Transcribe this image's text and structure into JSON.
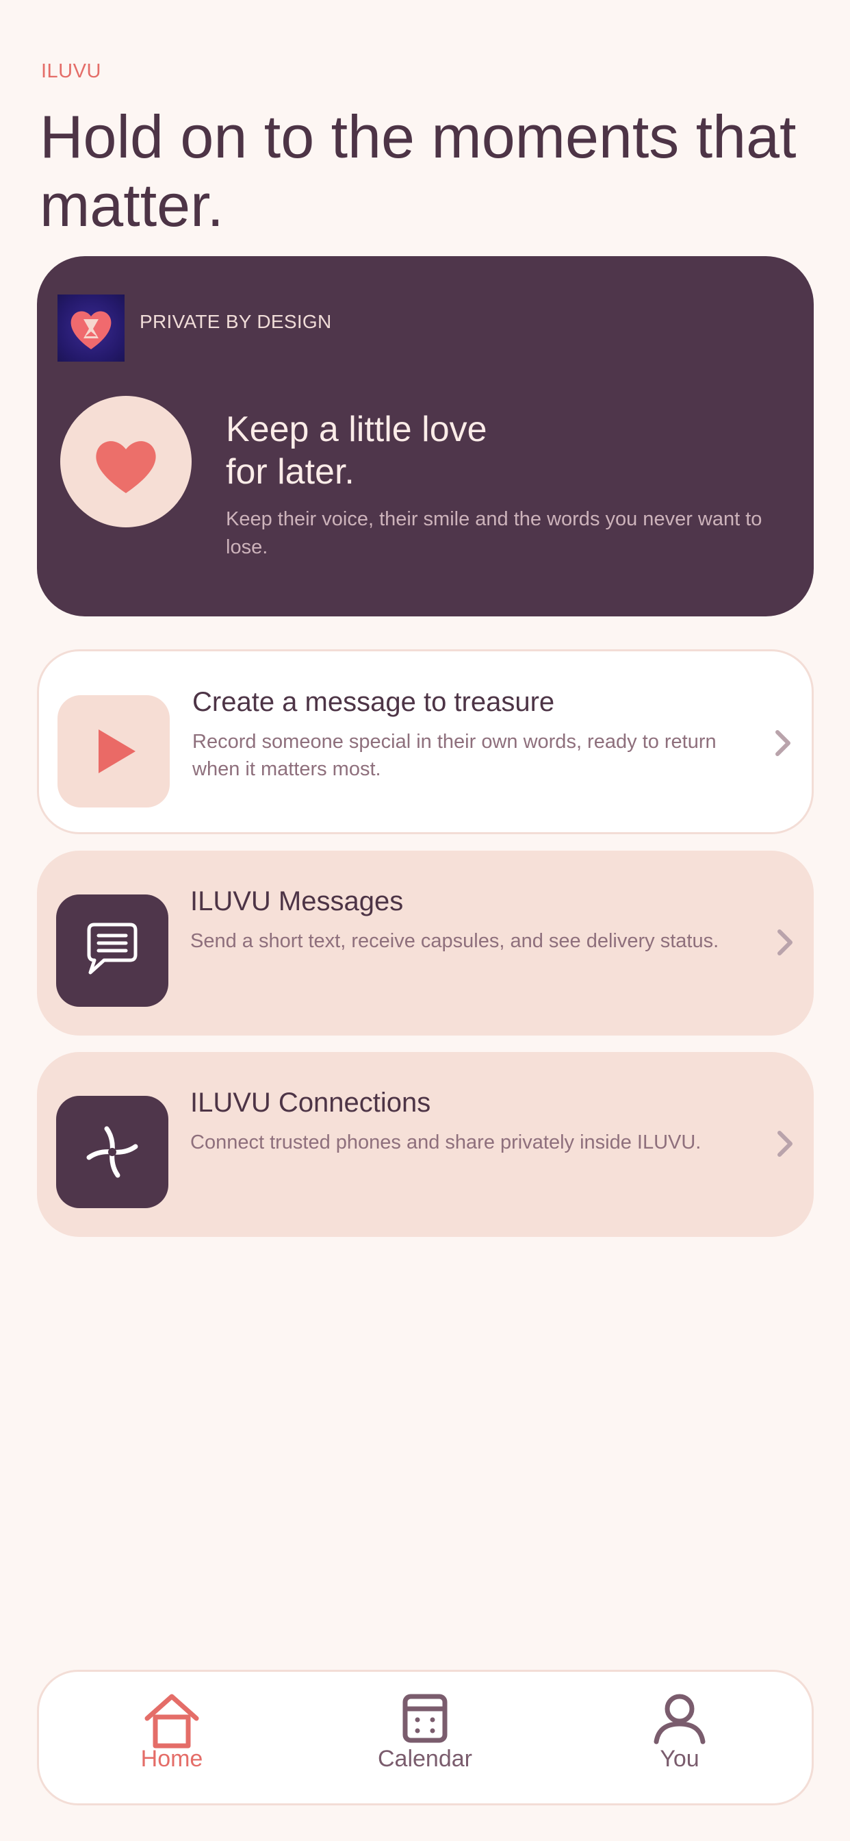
{
  "app": {
    "brand": "ILUVU"
  },
  "header": {
    "headline": "Hold on to the moments that matter."
  },
  "hero": {
    "tag": "PRIVATE BY DESIGN",
    "title_line1": "Keep a little love",
    "title_line2": "for later.",
    "subtitle": "Keep their voice, their smile and the words you never want to lose."
  },
  "cards": [
    {
      "title": "Create a message to treasure",
      "subtitle": "Record someone special in their own words, ready to return when it matters most.",
      "icon": "play-icon"
    },
    {
      "title": "ILUVU Messages",
      "subtitle": "Send a short text, receive capsules, and see delivery status.",
      "icon": "chat-bubble-icon"
    },
    {
      "title": "ILUVU Connections",
      "subtitle": "Connect trusted phones and share privately inside ILUVU.",
      "icon": "connections-icon"
    }
  ],
  "tabbar": {
    "items": [
      {
        "label": "Home",
        "icon": "home-icon",
        "active": true
      },
      {
        "label": "Calendar",
        "icon": "calendar-icon",
        "active": false
      },
      {
        "label": "You",
        "icon": "person-icon",
        "active": false
      }
    ]
  },
  "colors": {
    "background": "#fdf6f3",
    "accent": "#e46d68",
    "plum": "#4f364b",
    "blush": "#f6e0d8"
  }
}
